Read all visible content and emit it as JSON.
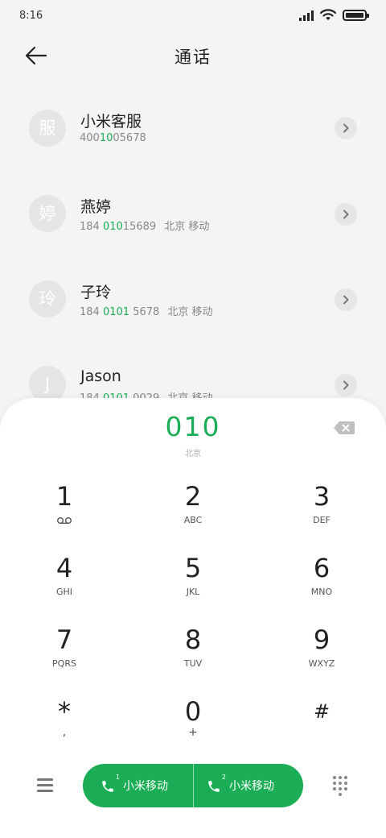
{
  "status_bar": {
    "time": "8:16"
  },
  "header": {
    "title": "通话"
  },
  "contacts": [
    {
      "avatar_text": "服",
      "name": "小米客服",
      "number_prefix": "400",
      "number_match": "10",
      "number_suffix": "05678",
      "location": ""
    },
    {
      "avatar_text": "婷",
      "name": "燕婷",
      "number_prefix": "184 ",
      "number_match": "010",
      "number_suffix": "15689",
      "location": "北京 移动"
    },
    {
      "avatar_text": "玲",
      "name": "子玲",
      "number_prefix": "184 ",
      "number_match": "0101",
      "number_suffix": " 5678",
      "location": "北京 移动"
    },
    {
      "avatar_text": "J",
      "name": "Jason",
      "number_prefix": "184 ",
      "number_match": "0101",
      "number_suffix": " 0029",
      "location": "北京 移动"
    }
  ],
  "dialer": {
    "input": "010",
    "location": "北京",
    "keys": [
      {
        "digit": "1",
        "letters": ""
      },
      {
        "digit": "2",
        "letters": "ABC"
      },
      {
        "digit": "3",
        "letters": "DEF"
      },
      {
        "digit": "4",
        "letters": "GHI"
      },
      {
        "digit": "5",
        "letters": "JKL"
      },
      {
        "digit": "6",
        "letters": "MNO"
      },
      {
        "digit": "7",
        "letters": "PQRS"
      },
      {
        "digit": "8",
        "letters": "TUV"
      },
      {
        "digit": "9",
        "letters": "WXYZ"
      },
      {
        "digit": "*",
        "letters": ","
      },
      {
        "digit": "0",
        "letters": "+"
      },
      {
        "digit": "#",
        "letters": ""
      }
    ]
  },
  "call_buttons": [
    {
      "sim": "1",
      "label": "小米移动"
    },
    {
      "sim": "2",
      "label": "小米移动"
    }
  ],
  "colors": {
    "accent": "#1aad56",
    "background": "#f4f4f4",
    "avatar": "#e5e5e5"
  },
  "icons": {
    "back": "arrow-left-icon",
    "chevron": "chevron-right-icon",
    "delete": "backspace-icon",
    "voicemail": "voicemail-icon",
    "menu": "menu-icon",
    "phone": "phone-icon",
    "keypad": "dialpad-icon"
  }
}
